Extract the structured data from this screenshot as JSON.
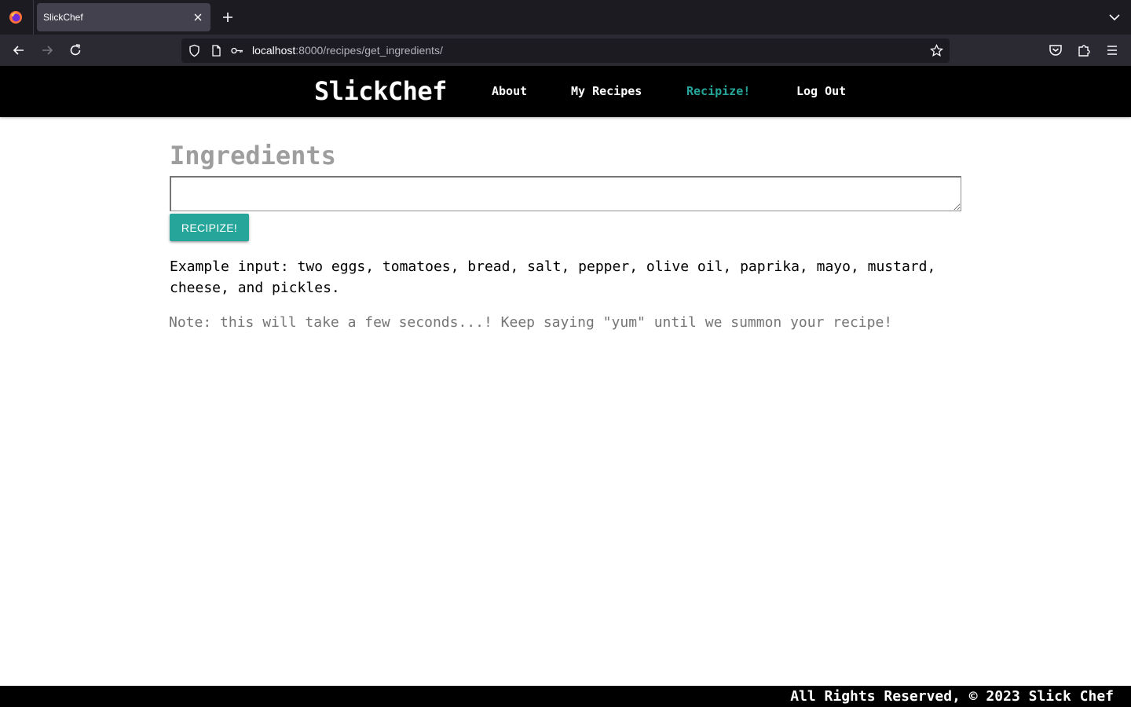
{
  "browser": {
    "tab_title": "SlickChef",
    "url_host": "localhost",
    "url_path": ":8000/recipes/get_ingredients/"
  },
  "site": {
    "brand": "SlickChef",
    "nav": [
      {
        "label": "About"
      },
      {
        "label": "My Recipes"
      },
      {
        "label": "Recipize!",
        "active": true
      },
      {
        "label": "Log Out"
      }
    ]
  },
  "main": {
    "heading": "Ingredients",
    "input_value": "",
    "button_label": "RECIPIZE!",
    "example_text": "Example input: two eggs, tomatoes, bread, salt, pepper, olive oil, paprika, mayo, mustard, cheese, and pickles.",
    "note_text": "Note: this will take a few seconds...! Keep saying \"yum\" until we summon your recipe!"
  },
  "footer": {
    "text": "All Rights Reserved, © 2023 Slick Chef"
  },
  "colors": {
    "accent": "#26a69a",
    "header_bg": "#000000",
    "heading_gray": "#9e9e9e",
    "note_gray": "#757575",
    "chrome_dark": "#1c1b22",
    "chrome_toolbar": "#2b2a33"
  }
}
